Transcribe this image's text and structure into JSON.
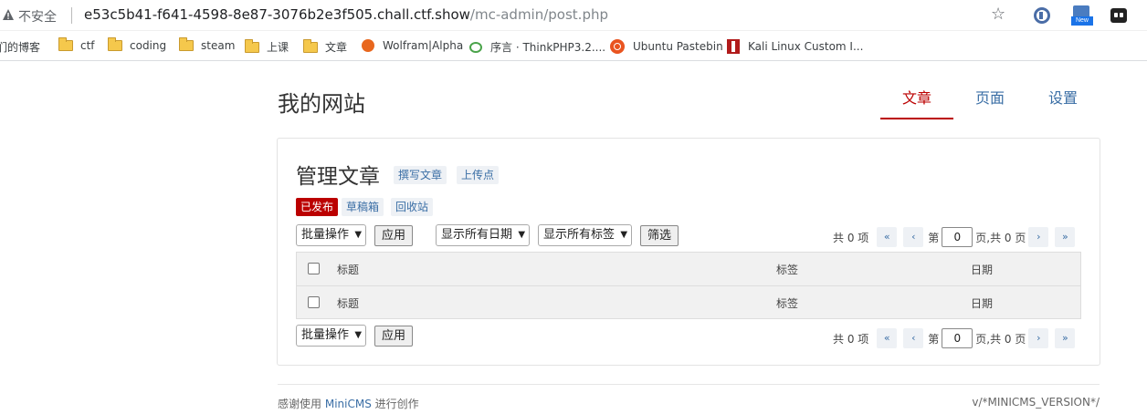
{
  "browser": {
    "insecure_label": "不安全",
    "url_host": "e53c5b41-f641-4598-8e87-3076b2e3f505.chall.ctf.show",
    "url_path": "/mc-admin/post.php",
    "new_badge": "New"
  },
  "bookmarks": [
    {
      "label": "们的博客"
    },
    {
      "label": "ctf"
    },
    {
      "label": "coding"
    },
    {
      "label": "steam"
    },
    {
      "label": "上课"
    },
    {
      "label": "文章"
    },
    {
      "label": "Wolfram|Alpha"
    },
    {
      "label": "序言 · ThinkPHP3.2...."
    },
    {
      "label": "Ubuntu Pastebin"
    },
    {
      "label": "Kali Linux Custom I..."
    }
  ],
  "site": {
    "title": "我的网站"
  },
  "nav": [
    {
      "label": "文章",
      "active": true
    },
    {
      "label": "页面",
      "active": false
    },
    {
      "label": "设置",
      "active": false
    }
  ],
  "panel": {
    "title": "管理文章",
    "write_label": "撰写文章",
    "upload_label": "上传点",
    "filters": [
      "已发布",
      "草稿箱",
      "回收站"
    ],
    "bulk_action": "批量操作",
    "apply_label": "应用",
    "date_filter": "显示所有日期",
    "tag_filter": "显示所有标签",
    "filter_label": "筛选",
    "pager": {
      "total": "共 0 项",
      "first": "«",
      "prev": "‹",
      "page_prefix": "第",
      "page_value": "0",
      "page_suffix": "页,共 0 页",
      "next": "›",
      "last": "»"
    },
    "columns": {
      "title": "标题",
      "tags": "标签",
      "date": "日期"
    }
  },
  "footer": {
    "thanks_prefix": "感谢使用",
    "link": "MiniCMS",
    "thanks_suffix": "进行创作",
    "version": "v/*MINICMS_VERSION*/"
  }
}
